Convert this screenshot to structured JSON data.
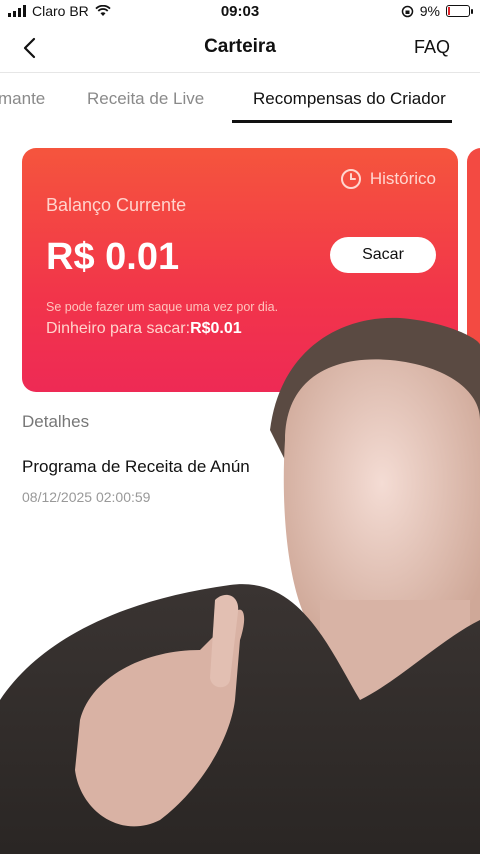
{
  "status_bar": {
    "carrier": "Claro BR",
    "time": "09:03",
    "battery_percent": "9%"
  },
  "header": {
    "title": "Carteira",
    "faq": "FAQ"
  },
  "tabs": [
    {
      "label": "mante",
      "active": false
    },
    {
      "label": "Receita de Live",
      "active": false
    },
    {
      "label": "Recompensas do Criador",
      "active": true
    }
  ],
  "card": {
    "history_label": "Histórico",
    "balance_label": "Balanço Currente",
    "amount": "R$ 0.01",
    "withdraw_button": "Sacar",
    "note": "Se pode fazer um saque uma vez por dia.",
    "withdrawable_label": "Dinheiro para sacar:",
    "withdrawable_value": "R$0.01"
  },
  "details": {
    "section_label": "Detalhes",
    "items": [
      {
        "title": "Programa de Receita de Anún",
        "date": "08/12/2025 02:00:59"
      }
    ]
  },
  "colors": {
    "card_top": "#f5553d",
    "card_bottom": "#ee2a55",
    "tab_underline": "#111111"
  },
  "icons": [
    "wifi-icon",
    "back-chevron-icon",
    "clock-icon",
    "battery-icon",
    "orientation-lock-icon"
  ],
  "battery_level": 0.09
}
